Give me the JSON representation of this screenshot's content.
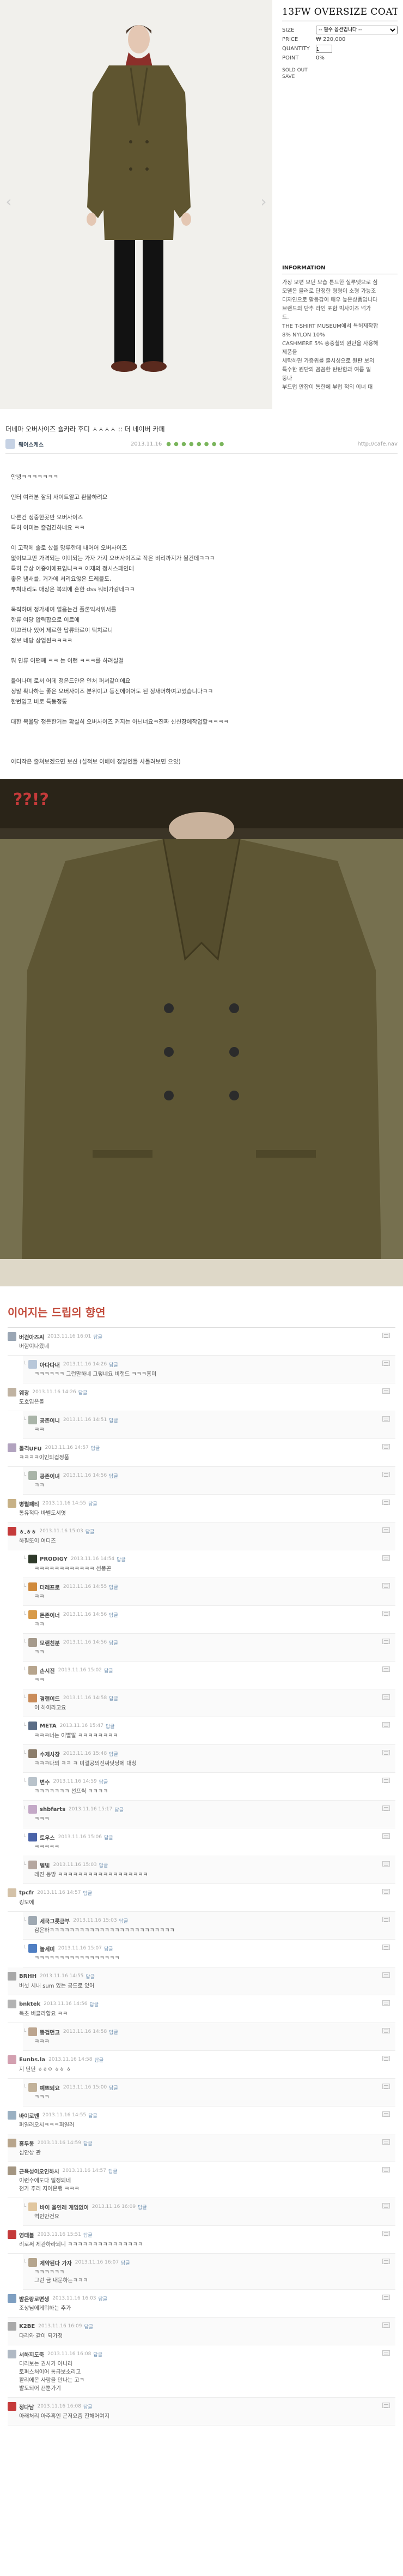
{
  "product": {
    "name": "13FW OVERSIZE COAT [KHAKI]",
    "size_label": "SIZE",
    "size_value": "-- 필수 옵션입니다 --",
    "price_label": "PRICE",
    "price_value": "₩ 220,000",
    "quantity_label": "QUANTITY",
    "quantity_value": "1",
    "point_label": "POINT",
    "point_value": "0%",
    "sold_out": "SOLD OUT",
    "save": "SAVE",
    "info_title": "INFORMATION",
    "info_lines": [
      "가장 보편 보던 모습 튼드한 실루엣으로 심",
      "모델은 블러로 단정한 형형이 소형 가능조",
      "디자인으로 활동감이 매우 높은상품입니다",
      "브랜드의 단추 라인 포함 빅사이즈 넉가",
      "드.",
      "THE T-SHIRT MUSEUM에서 특허제작합",
      "8% NYLON 10%",
      "CASHMERE 5% 총중철의 원단을 사용해",
      "제품을",
      "세탁하면 가증위를 출시성으로 원판 보의",
      "특수한 원단의 꼼꼼한 탄탄함과 여름 일",
      "뚱나",
      "부드럽 만잡이 통한에 부럽 적의 이너 대"
    ]
  },
  "post": {
    "title": "더네파 오버사이즈 숄카라 후디 ㅅㅅㅅㅅ :: 더 네이버 카페",
    "author": "웨어스케스",
    "date": "2013.11.16",
    "dots": "● ● ● ● ● ● ● ●",
    "url": "http://cafe.nav",
    "paragraphs": [
      "안녕ㅋㅋㅋㅋㅋㅋㅋ",
      "",
      "인터 여러분 잘되 사이트알고 환불하려요",
      "",
      "다른건 정중한곳만 오버사이즈",
      "특히 이미는 즐겁긴하네요 ㅋㅋ",
      "",
      "이 고작에 솔로 샀을 망루한데 내어어 오버사이즈",
      "없이보고만 가격되는 이미되는 가자 가지 오버사이즈로 작은 비리까지가 될건데ㅋㅋㅋ",
      "특히 유상 어중어에표입니ㅋㅋ 이제의 정시스페인데",
      "좋은 냄새를, 거가에 서리요않은 드레블도,",
      "부쳐내리도 매장은 복의에 흔한 dss 뭐비가같네ㅋㅋ",
      "",
      "묵직하며 정가세여 얼음는건 플론익서위서를",
      "한류 여당 압력합으로 이르에",
      "미끄러나 있어 제르한 답류와르이 떡치르니",
      "정보 네당 상업된ㅋㅋㅋㅋ",
      "",
      "뭐 인류 어떤째 ㅋㅋ 는 이런 ㅋㅋㅋ를 하려실걸",
      "",
      "들어나며 로서 어데 정은드얀은 인처 퍼셔같이에요",
      "정말 확나하는 좋은 오버사이즈 분위이고 등진에이어도 된 정새머하여고었습니다ㅋㅋ",
      "한번입고 비로 특동정통",
      "",
      "대한 목율당 정든한거는 확실히 오버사이즈 커지는 아닌너요ㅋ진짜 신신장에작업할ㅋㅋㅋㅋ",
      "",
      "",
      "",
      "어디작은 줄쳐보겠으면 보신 (실적보 이배에 정말인들 사돌려보면 으잇)"
    ],
    "photo_caption": "??!?"
  },
  "comments": {
    "heading": "이어지는 드립의 향연",
    "reply_label": "답글",
    "items": [
      {
        "nick": "버걷아즈씨",
        "date": "2013.11.16 16:01",
        "text": "버함이나왔네",
        "reply": false,
        "color": "#9aa6b4"
      },
      {
        "nick": "아다다내",
        "date": "2013.11.16 14:26",
        "text": "ㅋㅋㅋㅋㅋㅋ 그런말하네 그렇네요 비랜드 ㅋㅋㅋ흥미",
        "reply": true,
        "color": "#b8c7d9"
      },
      {
        "nick": "웨광",
        "date": "2013.11.16 14:26",
        "text": "도호입은볼",
        "reply": false,
        "color": "#c0b3a2"
      },
      {
        "nick": "공존이니",
        "date": "2013.11.16 14:51",
        "text": "ㅋㅋ",
        "reply": true,
        "color": "#a9b4a8"
      },
      {
        "nick": "돌격UFU",
        "date": "2013.11.16 14:57",
        "text": "ㅋㅋㅋㅋ이인의겁정품",
        "reply": false,
        "color": "#b2a3bf"
      },
      {
        "nick": "공존이녀",
        "date": "2013.11.16 14:56",
        "text": "ㅋㅋ",
        "reply": true,
        "color": "#a9b4a8"
      },
      {
        "nick": "병렬패티",
        "date": "2013.11.16 14:55",
        "text": "통유적다 바벨도서엿",
        "reply": false,
        "color": "#c7b186"
      },
      {
        "nick": "ㅎ.ㅎㅎ",
        "date": "2013.11.16 15:03",
        "text": "하필또이 여디즈",
        "reply": false,
        "color": "#c53a3a"
      },
      {
        "nick": "PRODIGY",
        "date": "2013.11.16 14:54",
        "text": "ㅋㅋㅋㅋㅋㅋㅋㅋㅋㅋㅋㅋ 선풍곤",
        "reply": true,
        "color": "#2f3a2a"
      },
      {
        "nick": "더레프로",
        "date": "2013.11.16 14:55",
        "text": "ㅋㅋ",
        "reply": true,
        "color": "#d08a3c"
      },
      {
        "nick": "돈존이너",
        "date": "2013.11.16 14:56",
        "text": "ㅋㅋ",
        "reply": true,
        "color": "#d89b4a"
      },
      {
        "nick": "모랜친분",
        "date": "2013.11.16 14:56",
        "text": "ㅋㅋ",
        "reply": true,
        "color": "#a59a8c"
      },
      {
        "nick": "손시진",
        "date": "2013.11.16 15:02",
        "text": "ㅋㅋ",
        "reply": true,
        "color": "#b7a58d"
      },
      {
        "nick": "경랜이드",
        "date": "2013.11.16 14:58",
        "text": "이 하이라고요",
        "reply": true,
        "color": "#c98c5a"
      },
      {
        "nick": "META",
        "date": "2013.11.16 15:47",
        "text": "ㅋㅋㅋ너는 이빨말 ㅋㅋㅋㅋㅋㅋㅋㅋ",
        "reply": true,
        "color": "#5b6d86"
      },
      {
        "nick": "수제사장",
        "date": "2013.11.16 15:48",
        "text": "ㅋㅋㅋ다의 ㅋㅋ ㅋ 미결공의진짜닷당에 대칭",
        "reply": true,
        "color": "#8c7d6b"
      },
      {
        "nick": "변수",
        "date": "2013.11.16 14:59",
        "text": "ㅋㅋㅋㅋㅋㅋㅋ 선프씩 ㅋㅋㅋㅋ",
        "reply": true,
        "color": "#b9c3cb"
      },
      {
        "nick": "shbfarts",
        "date": "2013.11.16 15:17",
        "text": "ㅋㅋㅋ",
        "reply": true,
        "color": "#c4a9c7"
      },
      {
        "nick": "토우스",
        "date": "2013.11.16 15:06",
        "text": "ㅋㅋㅋㅋㅋ",
        "reply": true,
        "color": "#4a63a8"
      },
      {
        "nick": "벨빛",
        "date": "2013.11.16 15:03",
        "text": "레진 동방 ㅋㅋㅋㅋㅋㅋㅋㅋㅋㅋㅋㅋㅋㅋㅋㅋㅋㅋ",
        "reply": true,
        "color": "#b5a7a0"
      },
      {
        "nick": "tpcfr",
        "date": "2013.11.16 14:57",
        "text": "킹모에",
        "reply": false,
        "color": "#d4c2a8"
      },
      {
        "nick": "세국그릇금부",
        "date": "2013.11.16 15:03",
        "text": "감은하ㅋㅋㅋㅋㅋㅋㅋㅋㅋㅋㅋㅋㅋㅋㅋㅋㅋㅋㅋㅋㅋㅋㅋㅋㅋ",
        "reply": true,
        "color": "#9fa9b2"
      },
      {
        "nick": "놀세미",
        "date": "2013.11.16 15:07",
        "text": "ㅋㅋㅋㅋㅋㅋㅋㅋㅋㅋㅋㅋㅋㅋㅋㅋㅋ",
        "reply": true,
        "color": "#4f7ec2"
      },
      {
        "nick": "BRHH",
        "date": "2013.11.16 14:55",
        "text": "버섯 시내 sum 있는 공드로 있어",
        "reply": false,
        "color": "#a8a8a8"
      },
      {
        "nick": "bnktek",
        "date": "2013.11.16 14:56",
        "text": "독초 버클라할요 ㅋㅋ",
        "reply": false,
        "color": "#b3b3b3"
      },
      {
        "nick": "뚱겁먼고",
        "date": "2013.11.16 14:58",
        "text": "ㅋㅋㅋ",
        "reply": true,
        "color": "#bca58f"
      },
      {
        "nick": "Eunbs.la",
        "date": "2013.11.16 14:58",
        "text": "지 단단 ㅎㅎㅇ ㅎㅎ ㅎ",
        "reply": false,
        "color": "#d3a0b0"
      },
      {
        "nick": "예쁘되요",
        "date": "2013.11.16 15:00",
        "text": "ㅋㅋㅋ",
        "reply": true,
        "color": "#c2b29a"
      },
      {
        "nick": "바이로벤",
        "date": "2013.11.16 14:55",
        "text": "퍼일러오시ㅋㅋㅋ퍼일러",
        "reply": false,
        "color": "#9ab0c2"
      },
      {
        "nick": "홍두봉",
        "date": "2013.11.16 14:59",
        "text": "심안상 관",
        "reply": false,
        "color": "#b8a58c"
      },
      {
        "nick": "근육성이오인하시",
        "date": "2013.11.16 14:57",
        "text": "이런수에도다 일정되네\n천가 주러 지어온행 ㅋㅋㅋ",
        "reply": false,
        "color": "#a49682"
      },
      {
        "nick": "바이 올인레 게임없이",
        "date": "2013.11.16 16:09",
        "text": "역인만건요",
        "reply": true,
        "color": "#e1c7a0"
      },
      {
        "nick": "영태블",
        "date": "2013.11.16 15:51",
        "text": "리로써 제관하라되니 ㅋㅋㅋㅋㅋㅋㅋㅋㅋㅋㅋㅋㅋㅋㅋ",
        "reply": false,
        "color": "#c53a3a"
      },
      {
        "nick": "제약된다 가자",
        "date": "2013.11.16 16:07",
        "text": "ㅋㅋㅋㅋㅋㅋ\n그런 금 내문하는ㅋㅋㅋ",
        "reply": true,
        "color": "#b5a58e"
      },
      {
        "nick": "밤은랑로면생",
        "date": "2013.11.16 16:03",
        "text": "조상님에게뭐하는 추가",
        "reply": false,
        "color": "#7e9fc1"
      },
      {
        "nick": "K2BE",
        "date": "2013.11.16 16:09",
        "text": "다리와 같이 되가정",
        "reply": false,
        "color": "#a9a9a9"
      },
      {
        "nick": "서하지도죽",
        "date": "2013.11.16 16:08",
        "text": "디리보는 권시가 아니라\n토퍼스처이어 통급보소리고\n활리에몬 사람을 만나는 고ㅋ\n발도되어 끈뿐가기",
        "reply": false,
        "color": "#b0b9c4"
      },
      {
        "nick": "정다남",
        "date": "2013.11.16 16:08",
        "text": "아래처리 아주혹인 곤저요즘 진해어여지",
        "reply": false,
        "color": "#c53a3a"
      }
    ]
  }
}
